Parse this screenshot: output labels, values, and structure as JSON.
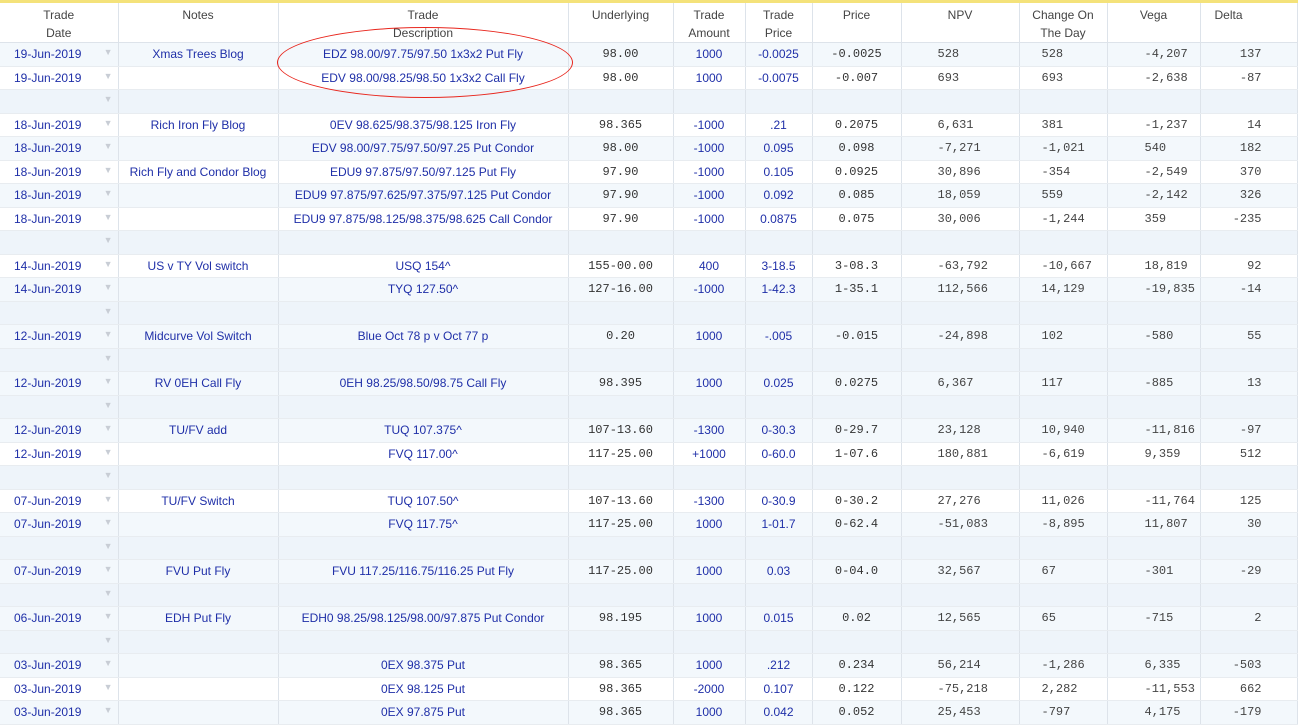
{
  "headers": {
    "trade_date": [
      "Trade",
      "Date"
    ],
    "notes": "Notes",
    "description": [
      "Trade",
      "Description"
    ],
    "underlying": "Underlying",
    "amount": [
      "Trade",
      "Amount"
    ],
    "trade_price": [
      "Trade",
      "Price"
    ],
    "price": "Price",
    "npv": "NPV",
    "change": [
      "Change On",
      "The Day"
    ],
    "vega": "Vega",
    "delta": "Delta"
  },
  "rows": [
    {
      "date": "19-Jun-2019",
      "notes": "Xmas Trees Blog",
      "desc": "EDZ 98.00/97.75/97.50 1x3x2 Put Fly",
      "und": "98.00",
      "amt": "1000",
      "tp": "-0.0025",
      "price": "-0.0025",
      "npv": "528",
      "chg": "528",
      "vega": "-4,207",
      "delta": "137"
    },
    {
      "date": "19-Jun-2019",
      "notes": "",
      "desc": "EDV 98.00/98.25/98.50 1x3x2 Call Fly",
      "und": "98.00",
      "amt": "1000",
      "tp": "-0.0075",
      "price": "-0.007",
      "npv": "693",
      "chg": "693",
      "vega": "-2,638",
      "delta": "-87"
    },
    {
      "blank": true
    },
    {
      "date": "18-Jun-2019",
      "notes": "Rich Iron Fly Blog",
      "desc": "0EV 98.625/98.375/98.125 Iron Fly",
      "und": "98.365",
      "amt": "-1000",
      "tp": ".21",
      "price": "0.2075",
      "npv": "6,631",
      "chg": "381",
      "vega": "-1,237",
      "delta": "14"
    },
    {
      "date": "18-Jun-2019",
      "notes": "",
      "desc": "EDV 98.00/97.75/97.50/97.25 Put Condor",
      "und": "98.00",
      "amt": "-1000",
      "tp": "0.095",
      "price": "0.098",
      "npv": "-7,271",
      "chg": "-1,021",
      "vega": "540",
      "delta": "182"
    },
    {
      "date": "18-Jun-2019",
      "notes": "Rich Fly and Condor Blog",
      "desc": "EDU9 97.875/97.50/97.125 Put Fly",
      "und": "97.90",
      "amt": "-1000",
      "tp": "0.105",
      "price": "0.0925",
      "npv": "30,896",
      "chg": "-354",
      "vega": "-2,549",
      "delta": "370"
    },
    {
      "date": "18-Jun-2019",
      "notes": "",
      "desc": "EDU9 97.875/97.625/97.375/97.125 Put Condor",
      "und": "97.90",
      "amt": "-1000",
      "tp": "0.092",
      "price": "0.085",
      "npv": "18,059",
      "chg": "559",
      "vega": "-2,142",
      "delta": "326"
    },
    {
      "date": "18-Jun-2019",
      "notes": "",
      "desc": "EDU9 97.875/98.125/98.375/98.625 Call Condor",
      "und": "97.90",
      "amt": "-1000",
      "tp": "0.0875",
      "price": "0.075",
      "npv": "30,006",
      "chg": "-1,244",
      "vega": "359",
      "delta": "-235"
    },
    {
      "blank": true
    },
    {
      "date": "14-Jun-2019",
      "notes": "US v TY Vol switch",
      "desc": "USQ 154^",
      "und": "155-00.00",
      "amt": "400",
      "tp": "3-18.5",
      "price": "3-08.3",
      "npv": "-63,792",
      "chg": "-10,667",
      "vega": "18,819",
      "delta": "92"
    },
    {
      "date": "14-Jun-2019",
      "notes": "",
      "desc": "TYQ 127.50^",
      "und": "127-16.00",
      "amt": "-1000",
      "tp": "1-42.3",
      "price": "1-35.1",
      "npv": "112,566",
      "chg": "14,129",
      "vega": "-19,835",
      "delta": "-14"
    },
    {
      "blank": true
    },
    {
      "date": "12-Jun-2019",
      "notes": "Midcurve Vol Switch",
      "desc": "Blue Oct 78 p v Oct 77 p",
      "und": "0.20",
      "amt": "1000",
      "tp": "-.005",
      "price": "-0.015",
      "npv": "-24,898",
      "chg": "102",
      "vega": "-580",
      "delta": "55"
    },
    {
      "blank": true
    },
    {
      "date": "12-Jun-2019",
      "notes": "RV 0EH Call Fly",
      "desc": "0EH 98.25/98.50/98.75 Call Fly",
      "und": "98.395",
      "amt": "1000",
      "tp": "0.025",
      "price": "0.0275",
      "npv": "6,367",
      "chg": "117",
      "vega": "-885",
      "delta": "13"
    },
    {
      "blank": true
    },
    {
      "date": "12-Jun-2019",
      "notes": "TU/FV add",
      "desc": "TUQ 107.375^",
      "und": "107-13.60",
      "amt": "-1300",
      "tp": "0-30.3",
      "price": "0-29.7",
      "npv": "23,128",
      "chg": "10,940",
      "vega": "-11,816",
      "delta": "-97"
    },
    {
      "date": "12-Jun-2019",
      "notes": "",
      "desc": "FVQ 117.00^",
      "und": "117-25.00",
      "amt": "+1000",
      "tp": "0-60.0",
      "price": "1-07.6",
      "npv": "180,881",
      "chg": "-6,619",
      "vega": "9,359",
      "delta": "512"
    },
    {
      "blank": true
    },
    {
      "date": "07-Jun-2019",
      "notes": "TU/FV Switch",
      "desc": "TUQ 107.50^",
      "und": "107-13.60",
      "amt": "-1300",
      "tp": "0-30.9",
      "price": "0-30.2",
      "npv": "27,276",
      "chg": "11,026",
      "vega": "-11,764",
      "delta": "125"
    },
    {
      "date": "07-Jun-2019",
      "notes": "",
      "desc": "FVQ 117.75^",
      "und": "117-25.00",
      "amt": "1000",
      "tp": "1-01.7",
      "price": "0-62.4",
      "npv": "-51,083",
      "chg": "-8,895",
      "vega": "11,807",
      "delta": "30"
    },
    {
      "blank": true
    },
    {
      "date": "07-Jun-2019",
      "notes": "FVU Put Fly",
      "desc": "FVU 117.25/116.75/116.25 Put Fly",
      "und": "117-25.00",
      "amt": "1000",
      "tp": "0.03",
      "price": "0-04.0",
      "npv": "32,567",
      "chg": "67",
      "vega": "-301",
      "delta": "-29"
    },
    {
      "blank": true
    },
    {
      "date": "06-Jun-2019",
      "notes": "EDH Put Fly",
      "desc": "EDH0 98.25/98.125/98.00/97.875 Put Condor",
      "und": "98.195",
      "amt": "1000",
      "tp": "0.015",
      "price": "0.02",
      "npv": "12,565",
      "chg": "65",
      "vega": "-715",
      "delta": "2"
    },
    {
      "blank": true
    },
    {
      "date": "03-Jun-2019",
      "notes": "",
      "desc": "0EX 98.375 Put",
      "und": "98.365",
      "amt": "1000",
      "tp": ".212",
      "price": "0.234",
      "npv": "56,214",
      "chg": "-1,286",
      "vega": "6,335",
      "delta": "-503"
    },
    {
      "date": "03-Jun-2019",
      "notes": "",
      "desc": "0EX 98.125 Put",
      "und": "98.365",
      "amt": "-2000",
      "tp": "0.107",
      "price": "0.122",
      "npv": "-75,218",
      "chg": "2,282",
      "vega": "-11,553",
      "delta": "662"
    },
    {
      "date": "03-Jun-2019",
      "notes": "",
      "desc": "0EX 97.875 Put",
      "und": "98.365",
      "amt": "1000",
      "tp": "0.042",
      "price": "0.052",
      "npv": "25,453",
      "chg": "-797",
      "vega": "4,175",
      "delta": "-179"
    }
  ],
  "row_arrow": "▼",
  "colors": {
    "text_blue": "#1f2fa8",
    "header_border": "#f4e27a",
    "highlight_oval": "#e8261d",
    "row_alt": "#f3f8fc"
  }
}
